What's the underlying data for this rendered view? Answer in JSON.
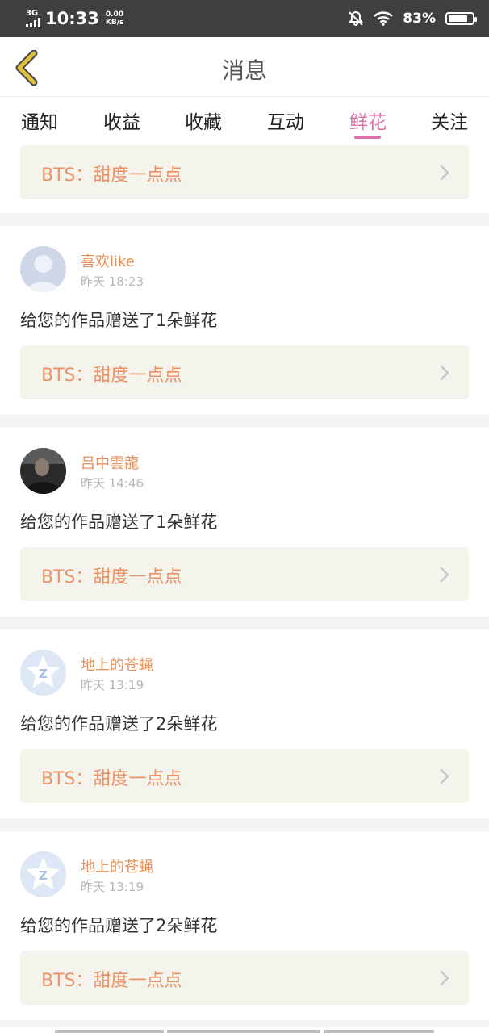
{
  "status_bar": {
    "network_type": "3G",
    "time": "10:33",
    "speed_value": "0.00",
    "speed_unit": "KB/s",
    "battery": "83%",
    "battery_level": 0.83,
    "icons": [
      "signal-icon",
      "bell-off-icon",
      "wifi-icon",
      "battery-icon"
    ]
  },
  "header": {
    "title": "消息",
    "back_icon": "chevron-left-icon",
    "accent_color": "#e2c13a"
  },
  "tabs": [
    {
      "label": "通知",
      "active": false
    },
    {
      "label": "收益",
      "active": false
    },
    {
      "label": "收藏",
      "active": false
    },
    {
      "label": "互动",
      "active": false
    },
    {
      "label": "鲜花",
      "active": true
    },
    {
      "label": "关注",
      "active": false
    }
  ],
  "active_tab_color": "#e070a8",
  "first_card": {
    "work_title": "BTS：甜度一点点"
  },
  "messages": [
    {
      "username": "喜欢like",
      "time": "昨天 18:23",
      "text": "给您的作品赠送了1朵鲜花",
      "work_title": "BTS：甜度一点点",
      "avatar": "default-person-avatar"
    },
    {
      "username": "吕中雲龍",
      "time": "昨天 14:46",
      "text": "给您的作品赠送了1朵鲜花",
      "work_title": "BTS：甜度一点点",
      "avatar": "photo-avatar"
    },
    {
      "username": "地上的苍蝇",
      "time": "昨天 13:19",
      "text": "给您的作品赠送了2朵鲜花",
      "work_title": "BTS：甜度一点点",
      "avatar": "star-badge-avatar"
    },
    {
      "username": "地上的苍蝇",
      "time": "昨天 13:19",
      "text": "给您的作品赠送了2朵鲜花",
      "work_title": "BTS：甜度一点点",
      "avatar": "star-badge-avatar"
    }
  ],
  "colors": {
    "username": "#e89058",
    "work_title": "#ec9266",
    "work_bg": "#f5f4ec"
  }
}
